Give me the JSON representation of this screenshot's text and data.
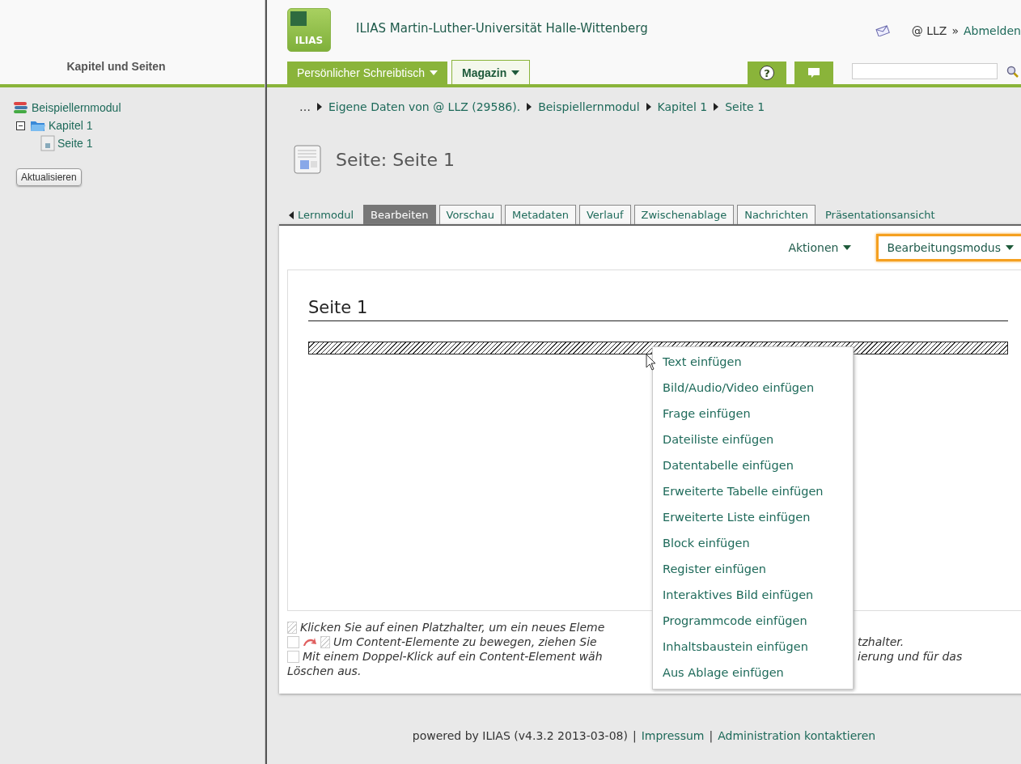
{
  "sidebar": {
    "title": "Kapitel und Seiten",
    "tree": [
      {
        "label": "Beispiellernmodul",
        "kind": "module",
        "children": [
          {
            "label": "Kapitel 1",
            "kind": "chapter",
            "expanded": true,
            "children": [
              {
                "label": "Seite 1",
                "kind": "page"
              }
            ]
          }
        ]
      }
    ],
    "refresh_button": "Aktualisieren"
  },
  "header": {
    "logo": "ILIAS",
    "title": "ILIAS Martin-Luther-Universität Halle-Wittenberg",
    "user": "@ LLZ",
    "separator": "»",
    "logout": "Abmelden"
  },
  "nav": [
    {
      "label": "Persönlicher Schreibtisch",
      "selected": false
    },
    {
      "label": "Magazin",
      "selected": true
    }
  ],
  "help_button": "?",
  "breadcrumbs": [
    "…",
    "Eigene Daten von @ LLZ (29586).",
    "Beispiellernmodul",
    "Kapitel 1",
    "Seite 1"
  ],
  "page_title": "Seite: Seite 1",
  "tabs": [
    {
      "label": "Lernmodul",
      "kind": "back",
      "selected": false
    },
    {
      "label": "Bearbeiten",
      "kind": "tab",
      "selected": true
    },
    {
      "label": "Vorschau",
      "kind": "tab",
      "selected": false
    },
    {
      "label": "Metadaten",
      "kind": "tab",
      "selected": false
    },
    {
      "label": "Verlauf",
      "kind": "tab",
      "selected": false
    },
    {
      "label": "Zwischenablage",
      "kind": "tab",
      "selected": false
    },
    {
      "label": "Nachrichten",
      "kind": "tab",
      "selected": false
    },
    {
      "label": "Präsentationsansicht",
      "kind": "link",
      "selected": false
    }
  ],
  "actions": [
    {
      "label": "Aktionen",
      "highlighted": false
    },
    {
      "label": "Bearbeitungsmodus",
      "highlighted": true
    }
  ],
  "editor": {
    "heading": "Seite 1"
  },
  "insert_menu": [
    "Text einfügen",
    "Bild/Audio/Video einfügen",
    "Frage einfügen",
    "Dateiliste einfügen",
    "Datentabelle einfügen",
    "Erweiterte Tabelle einfügen",
    "Erweiterte Liste einfügen",
    "Block einfügen",
    "Register einfügen",
    "Interaktives Bild einfügen",
    "Programmcode einfügen",
    "Inhaltsbaustein einfügen",
    "Aus Ablage einfügen"
  ],
  "help_lines": [
    {
      "kind": "insert",
      "left": "Klicken Sie auf einen Platzhalter, um ein neues Eleme"
    },
    {
      "kind": "move",
      "left": "Um Content-Elemente zu bewegen, ziehen Sie",
      "right": "tzhalter."
    },
    {
      "kind": "edit",
      "left": "Mit einem Doppel-Klick auf ein Content-Element wäh",
      "right": "ierung und für das"
    }
  ],
  "help_tail": "Löschen aus.",
  "footer": {
    "powered": "powered by ILIAS (v4.3.2 2013-03-08)",
    "separator": "|",
    "links": [
      "Impressum",
      "Administration kontaktieren"
    ]
  }
}
